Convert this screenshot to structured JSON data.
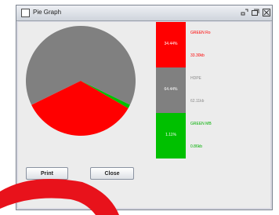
{
  "window": {
    "title": "Pie Graph",
    "controls": [
      "minimize-icon",
      "maximize-icon",
      "close-icon"
    ]
  },
  "segments": [
    {
      "label": "GREEN Ro",
      "percent": "34.44%",
      "size": "33.30kb",
      "color": "#ff0000",
      "text_color": "#ff0000",
      "fraction": 0.3444
    },
    {
      "label": "HDPE",
      "percent": "64.44%",
      "size": "62.11kb",
      "color": "#808080",
      "text_color": "#8a8a8a",
      "fraction": 0.6444
    },
    {
      "label": "GREEN MB",
      "percent": "1.11%",
      "size": "0.86kb",
      "color": "#00c000",
      "text_color": "#00b000",
      "fraction": 0.0111
    }
  ],
  "buttons": {
    "print": "Print",
    "close": "Close"
  },
  "colors": {
    "window_bg": "#d9d9e2",
    "content_bg": "#ececec",
    "overlay_arc": "#e8121b"
  }
}
